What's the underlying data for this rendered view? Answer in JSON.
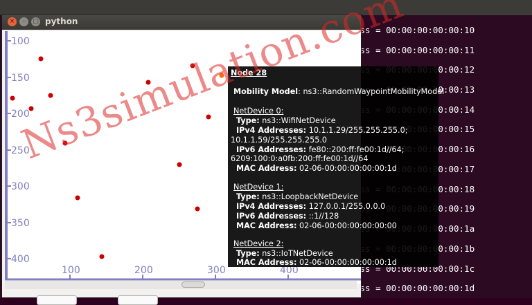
{
  "terminal": {
    "lines": [
      "ess = 00:00:00:00:00:10",
      "ess = 00:00:00:00:00:11",
      "ess = 00:00:00:00:00:12",
      "ess = 00:00:00:00:00:13",
      "ess = 00:00:00:00:00:14",
      "ess = 00:00:00:00:00:15",
      "ess = 00:00:00:00:00:16",
      "ess = 00:00:00:00:00:17",
      "ess = 00:00:00:00:00:18",
      "ess = 00:00:00:00:00:19",
      "ess = 00:00:00:00:00:1a",
      "ess = 00:00:00:00:00:1b",
      "ess = 00:00:00:00:00:1c",
      "ess = 00:00:00:00:00:1d"
    ]
  },
  "window": {
    "title": "python",
    "close_glyph": "×",
    "min_glyph": "–",
    "max_glyph": "□"
  },
  "plot": {
    "y_ticks": [
      "100",
      "150",
      "200",
      "250",
      "300",
      "350",
      "400"
    ],
    "x_ticks": [
      "100",
      "200",
      "300",
      "400"
    ],
    "axis_color": "#8080c0",
    "node_color": "#cc0000",
    "highlight_color": "#ff6a00"
  },
  "tooltip": {
    "node_title": "Node 28",
    "mobility_label": "Mobility Model",
    "mobility_value": ": ns3::RandomWaypointMobilityModel",
    "dev0": {
      "header": "NetDevice 0:",
      "type_label": "Type:",
      "type_value": " ns3::WifiNetDevice",
      "ipv4_label": "IPv4 Addresses:",
      "ipv4_value": " 10.1.1.29/255.255.255.0;",
      "ipv4_value2": "10.1.1.59/255.255.255.0",
      "ipv6_label": "IPv6 Addresses:",
      "ipv6_value": " fe80::200:ff:fe00:1d//64;",
      "ipv6_value2": "6209:100:0:a0fb:200:ff:fe00:1d//64",
      "mac_label": "MAC Address:",
      "mac_value": " 02-06-00:00:00:00:00:1d"
    },
    "dev1": {
      "header": "NetDevice 1:",
      "type_label": "Type:",
      "type_value": " ns3::LoopbackNetDevice",
      "ipv4_label": "IPv4 Addresses:",
      "ipv4_value": " 127.0.0.1/255.0.0.0",
      "ipv6_label": "IPv6 Addresses:",
      "ipv6_value": " ::1//128",
      "mac_label": "MAC Address:",
      "mac_value": " 02-06-00:00:00:00:00:00"
    },
    "dev2": {
      "header": "NetDevice 2:",
      "type_label": "Type:",
      "type_value": " ns3::IoTNetDevice",
      "mac_label": "MAC Address:",
      "mac_value": " 02-06-00:00:00:00:00:1d"
    }
  },
  "watermark": "Ns3simulation.com"
}
